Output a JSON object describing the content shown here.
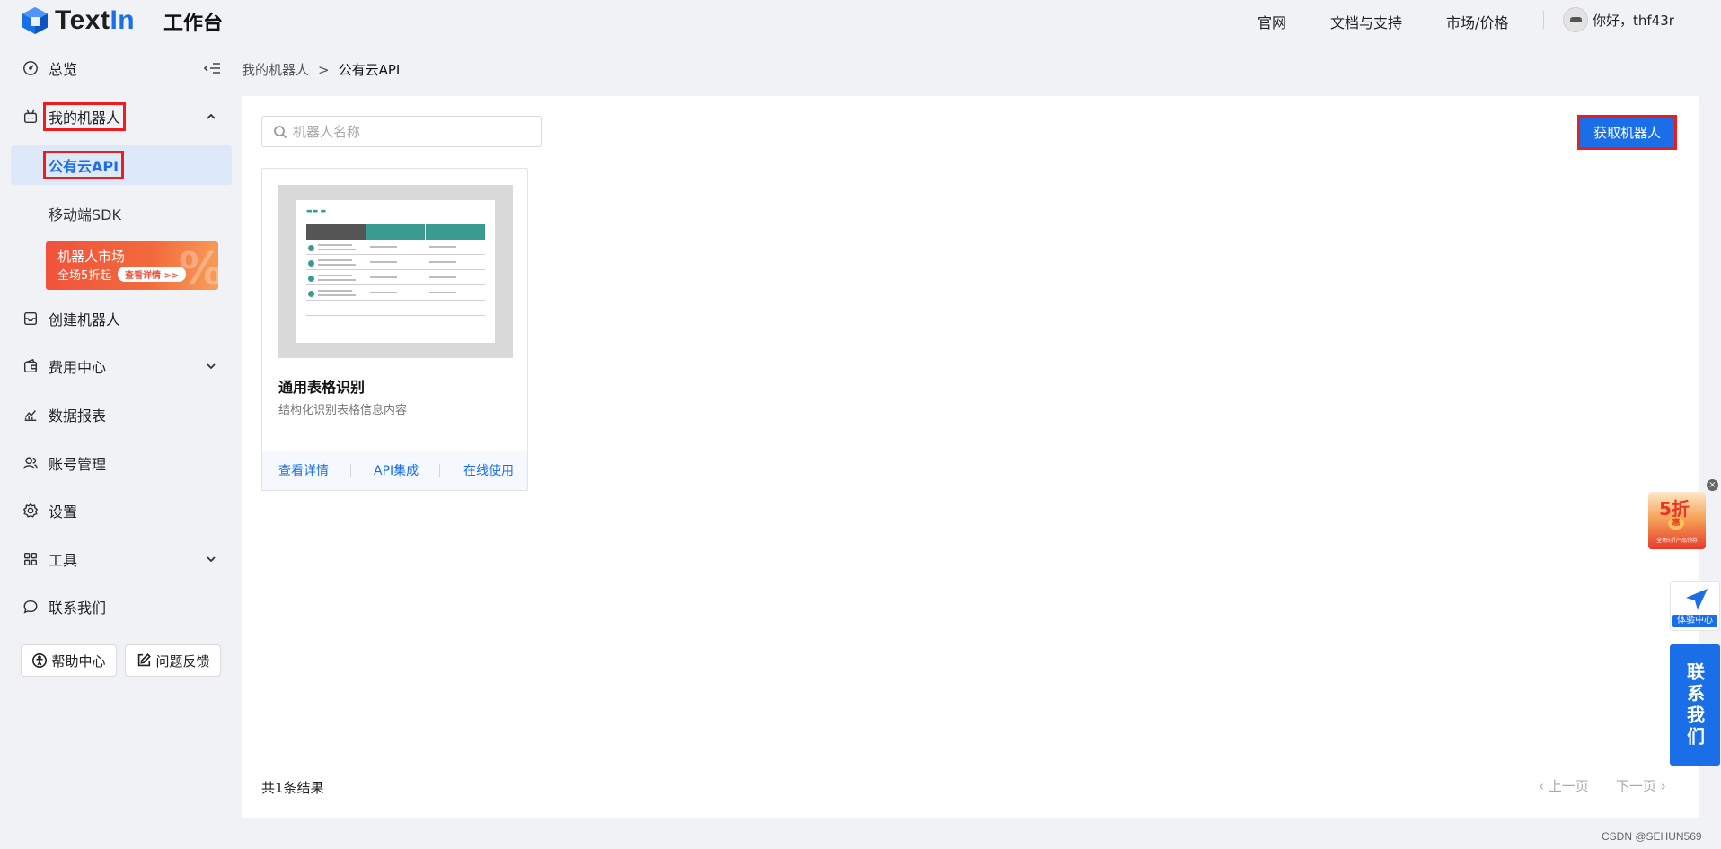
{
  "app": {
    "brand_part1": "Text",
    "brand_part2": "In",
    "workbench": "工作台"
  },
  "topnav": {
    "items": [
      {
        "label": "官网"
      },
      {
        "label": "文档与支持"
      },
      {
        "label": "市场/价格"
      }
    ],
    "user_greeting": "你好，thf43r"
  },
  "sidebar": {
    "items": [
      {
        "label": "总览",
        "icon": "dashboard-icon"
      },
      {
        "label": "我的机器人",
        "icon": "robot-icon",
        "expanded": true
      },
      {
        "label": "创建机器人",
        "icon": "create-robot-icon"
      },
      {
        "label": "费用中心",
        "icon": "wallet-icon"
      },
      {
        "label": "数据报表",
        "icon": "chart-icon"
      },
      {
        "label": "账号管理",
        "icon": "users-icon"
      },
      {
        "label": "设置",
        "icon": "gear-icon"
      },
      {
        "label": "工具",
        "icon": "grid-icon"
      },
      {
        "label": "联系我们",
        "icon": "chat-icon"
      }
    ],
    "sub_items": [
      {
        "label": "公有云API",
        "active": true
      },
      {
        "label": "移动端SDK",
        "active": false
      }
    ],
    "promo": {
      "line1": "机器人市场",
      "line2": "全场5折起",
      "button": "查看详情 >>",
      "deco": "%"
    },
    "help_button": "帮助中心",
    "feedback_button": "问题反馈"
  },
  "breadcrumb": {
    "parent": "我的机器人",
    "separator": ">",
    "current": "公有云API"
  },
  "main": {
    "search_placeholder": "机器人名称",
    "get_robot_button": "获取机器人",
    "cards": [
      {
        "title": "通用表格识别",
        "description": "结构化识别表格信息内容",
        "actions": [
          "查看详情",
          "API集成",
          "在线使用"
        ]
      }
    ],
    "total_text": "共1条结果",
    "prev_page": "‹ 上一页",
    "next_page": "下一页 ›"
  },
  "floating": {
    "close": "×",
    "discount_title": "5折",
    "discount_coin": "惠",
    "discount_caption": "全场5折产品领券",
    "experience_label": "体验中心",
    "contact_label": "联系我们"
  },
  "watermark": "CSDN @SEHUN569",
  "colors": {
    "accent": "#1a6ee8",
    "highlight_border": "#ee1c1c",
    "active_bg": "#dde8f8",
    "promo": "#f0523c"
  }
}
